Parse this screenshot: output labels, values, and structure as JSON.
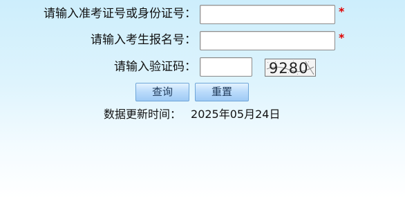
{
  "form": {
    "id_label": "请输入准考证号或身份证号：",
    "id_value": "",
    "id_required_mark": "*",
    "reg_label": "请输入考生报名号：",
    "reg_value": "",
    "reg_required_mark": "*",
    "captcha_label": "请输入验证码：",
    "captcha_value": "",
    "captcha_text": "9280"
  },
  "buttons": {
    "query_label": "查询",
    "reset_label": "重置"
  },
  "update": {
    "label": "数据更新时间：",
    "date": "2025年05月24日"
  },
  "colors": {
    "required": "#e00000",
    "button_border": "#6fa6d8"
  }
}
